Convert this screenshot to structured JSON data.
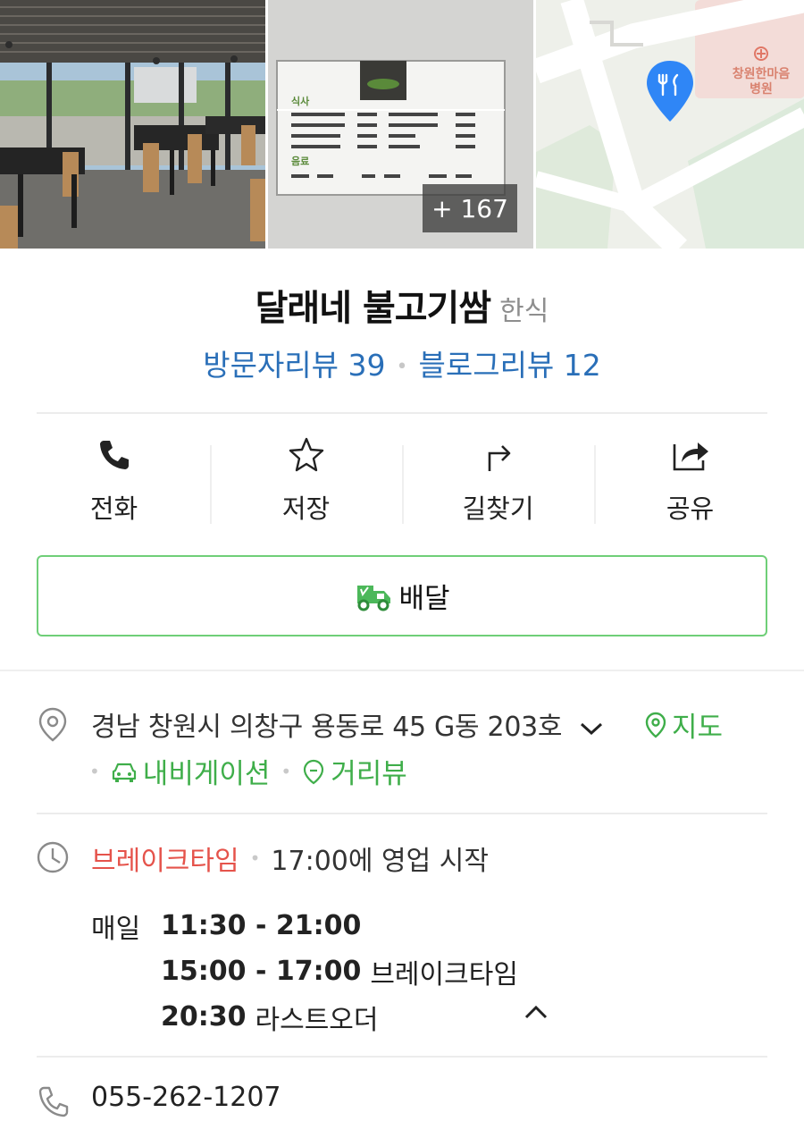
{
  "gallery": {
    "more_count": "+ 167",
    "menu_board": {
      "section_meal": "식사",
      "section_drink": "음료"
    }
  },
  "place": {
    "name": "달래네 불고기쌈",
    "category": "한식",
    "visitor_reviews": "방문자리뷰 39",
    "blog_reviews": "블로그리뷰 12"
  },
  "map": {
    "poi_label_line1": "창원한마음",
    "poi_label_line2": "병원"
  },
  "actions": {
    "call": "전화",
    "save": "저장",
    "directions": "길찾기",
    "share": "공유"
  },
  "delivery": {
    "label": "배달"
  },
  "address": {
    "text": "경남 창원시 의창구 용동로 45 G동 203호",
    "map_link": "지도",
    "navigation_link": "내비게이션",
    "street_view_link": "거리뷰"
  },
  "hours": {
    "status": "브레이크타임",
    "open_at": "17:00에 영업 시작",
    "day": "매일",
    "open_hours": "11:30 - 21:00",
    "break_hours": "15:00 - 17:00",
    "break_label": "브레이크타임",
    "last_order_time": "20:30",
    "last_order_label": "라스트오더"
  },
  "phone": {
    "number": "055-262-1207"
  },
  "colors": {
    "link_blue": "#2a6fb8",
    "green": "#3fae4a",
    "break_red": "#e5534b"
  }
}
